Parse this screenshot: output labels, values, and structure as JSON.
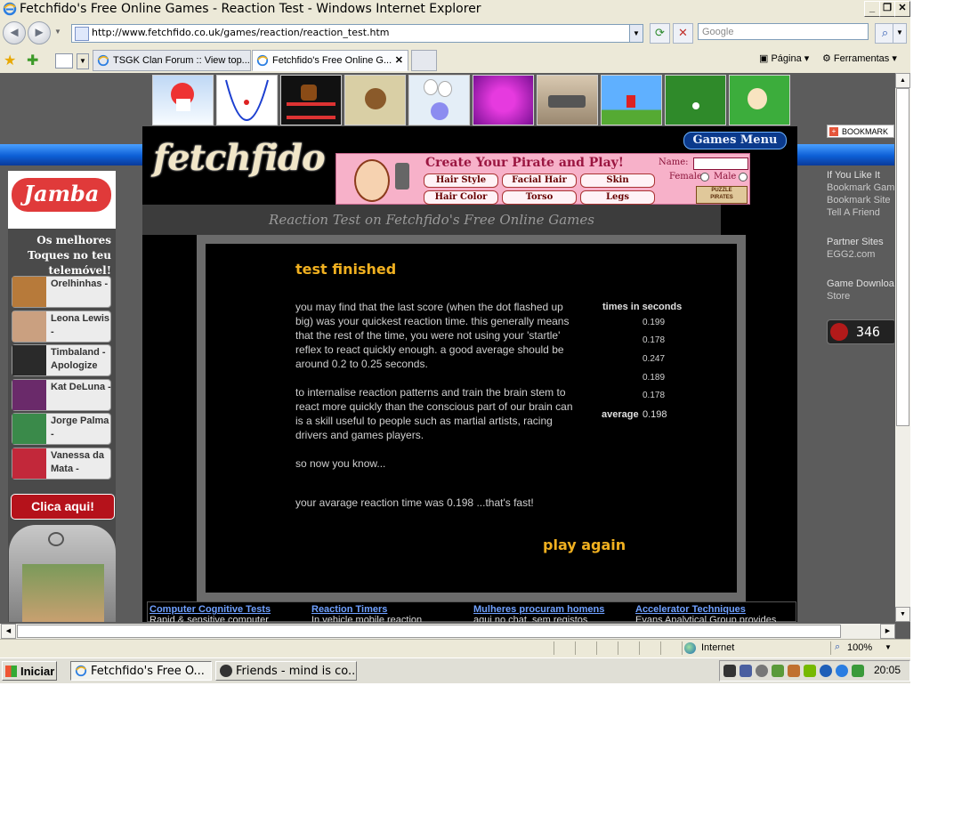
{
  "window": {
    "title": "Fetchfido's Free Online Games - Reaction Test - Windows Internet Explorer"
  },
  "address_bar": {
    "url": "http://www.fetchfido.co.uk/games/reaction/reaction_test.htm"
  },
  "search": {
    "placeholder": "Google"
  },
  "tabs": [
    {
      "label": "TSGK Clan Forum :: View top..."
    },
    {
      "label": "Fetchfido's Free Online G..."
    }
  ],
  "commands": {
    "page": "Página",
    "tools": "Ferramentas"
  },
  "site": {
    "logo": "fetchfido",
    "games_menu": "Games Menu",
    "page_title": "Reaction Test on Fetchfido's Free Online Games",
    "bookmark_label": "BOOKMARK"
  },
  "pirate_ad": {
    "title": "Create Your Pirate and Play!",
    "name_label": "Name:",
    "female_label": "Female",
    "male_label": "Male",
    "options": [
      "Hair Style",
      "Facial Hair",
      "Skin",
      "Hair Color",
      "Torso",
      "Legs"
    ],
    "logo_line1": "PUZZLE",
    "logo_line2": "PIRATES"
  },
  "game": {
    "heading": "test finished",
    "paragraph1": "you may find that the last score (when the dot flashed up big) was your quickest reaction time. this generally means that the rest of the time, you were not using your 'startle' reflex to react quickly enough. a good average should be around 0.2 to 0.25 seconds.",
    "paragraph2": "to internalise reaction patterns and train the brain stem to react more quickly than the conscious part of our brain can is a skill useful to people such as martial artists, racing drivers and games players.",
    "paragraph3": "so now you know...",
    "result": "your avarage reaction time was 0.198 ...that's fast!",
    "times_header": "times in seconds",
    "times": [
      "0.199",
      "0.178",
      "0.247",
      "0.189",
      "0.178"
    ],
    "average_label": "average",
    "average_value": "0.198",
    "play_again": "play again"
  },
  "left_ad": {
    "brand": "Jamba",
    "tagline": "Os melhores Toques no teu telemóvel!",
    "items": [
      {
        "text": "Orelhinhas -"
      },
      {
        "text": "Leona Lewis -"
      },
      {
        "text": "Timbaland - Apologize"
      },
      {
        "text": "Kat DeLuna -"
      },
      {
        "text": "Jorge Palma -"
      },
      {
        "text": "Vanessa da Mata -"
      }
    ],
    "cta": "Clica aqui!"
  },
  "right_sidebar": {
    "if_you_like": "If You Like It",
    "links1": [
      "Bookmark Game",
      "Bookmark Site",
      "Tell A Friend"
    ],
    "partner_header": "Partner Sites",
    "partner_link": "EGG2.com",
    "download_header": "Game Download",
    "download_link": "Store",
    "counter": "346"
  },
  "bottom_ads": [
    {
      "title": "Computer Cognitive Tests",
      "desc": "Rapid & sensitive computer"
    },
    {
      "title": "Reaction Timers",
      "desc": "In vehicle mobile reaction"
    },
    {
      "title": "Mulheres procuram homens",
      "desc": "aqui no chat. sem registos"
    },
    {
      "title": "Accelerator Techniques",
      "desc": "Evans Analytical Group provides"
    }
  ],
  "status_bar": {
    "zone": "Internet",
    "zoom": "100%"
  },
  "taskbar": {
    "start": "Iniciar",
    "tasks": [
      {
        "label": "Fetchfido's Free O..."
      },
      {
        "label": "Friends - mind is co..."
      }
    ],
    "clock": "20:05"
  },
  "colors": {
    "accent_blue": "#0d5fd6",
    "game_orange": "#f0b020",
    "ad_pink": "#f7b1c9"
  }
}
